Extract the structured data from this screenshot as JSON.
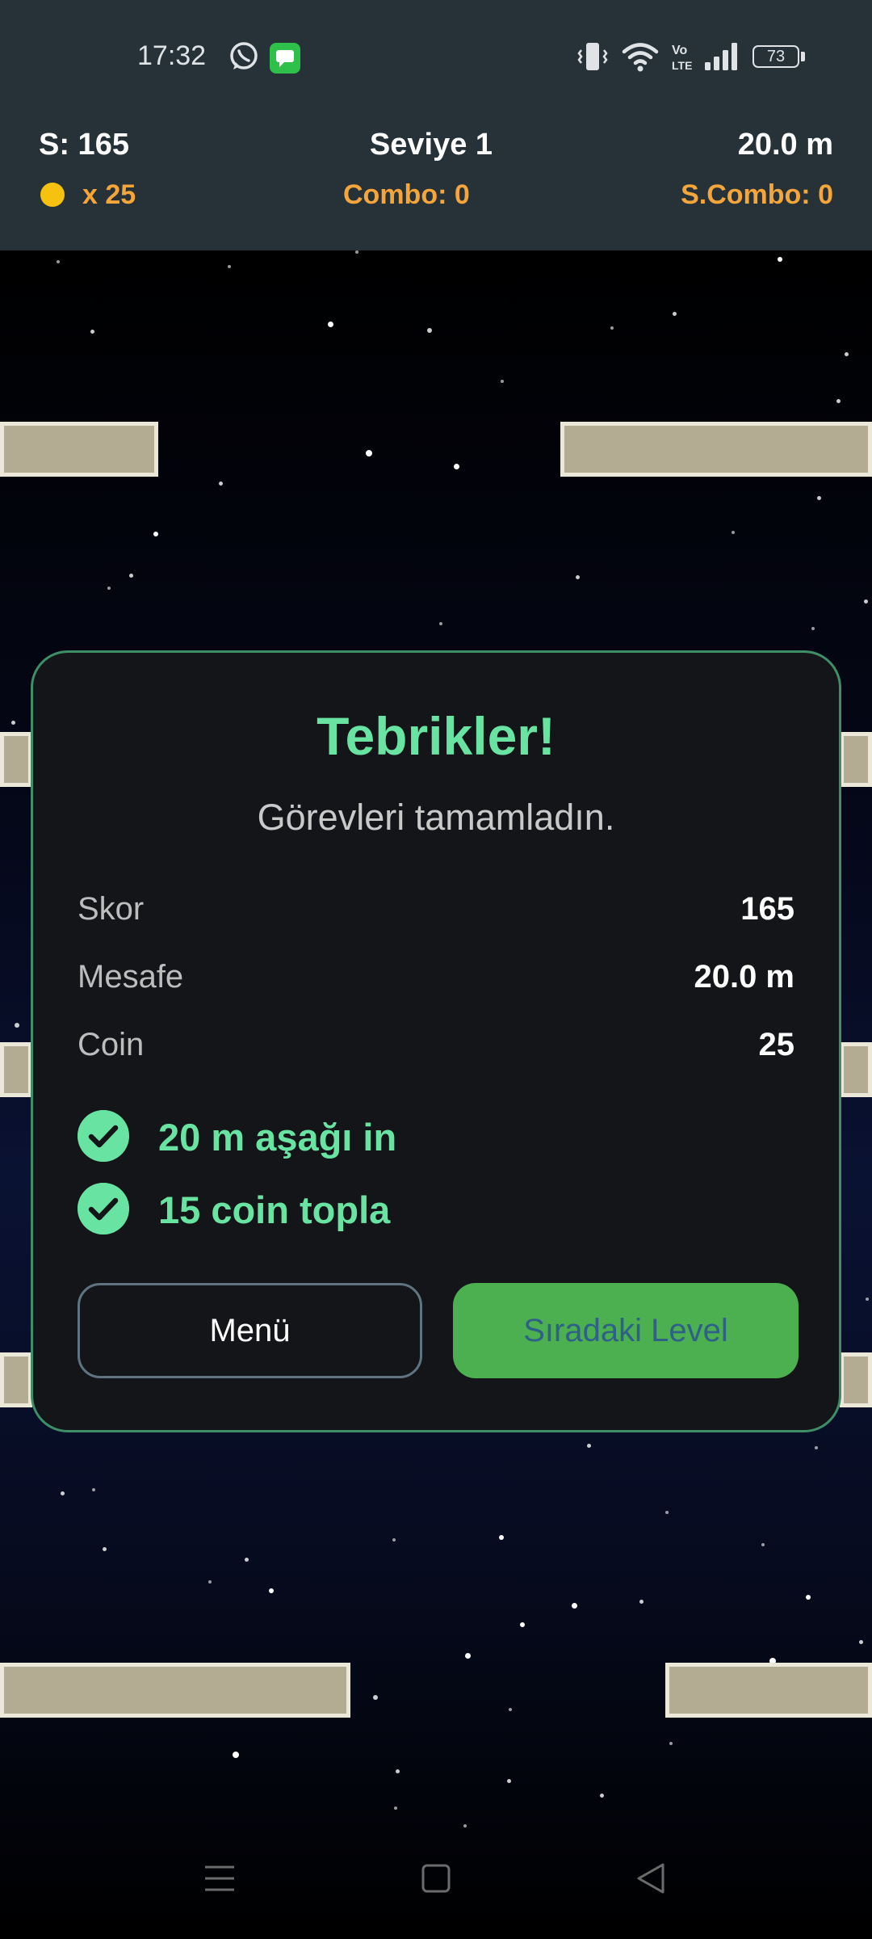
{
  "status_bar": {
    "time": "17:32",
    "icons": [
      "whatsapp-icon",
      "messages-icon",
      "vibrate-icon",
      "wifi-icon",
      "volte-icon",
      "signal-icon"
    ],
    "battery": "73"
  },
  "hud": {
    "score": "S: 165",
    "level": "Seviye 1",
    "distance": "20.0 m",
    "coins": "x 25",
    "combo": "Combo: 0",
    "super_combo": "S.Combo: 0",
    "colors": {
      "label": "#ffffff",
      "accent": "#f5a53a",
      "coin": "#f6c10f"
    }
  },
  "dialog": {
    "title": "Tebrikler!",
    "subtitle": "Görevleri tamamladın.",
    "stats": [
      {
        "label": "Skor",
        "value": "165"
      },
      {
        "label": "Mesafe",
        "value": "20.0 m"
      },
      {
        "label": "Coin",
        "value": "25"
      }
    ],
    "tasks": [
      {
        "label": "20 m aşağı in",
        "done": true
      },
      {
        "label": "15 coin topla",
        "done": true
      }
    ],
    "buttons": {
      "menu": "Menü",
      "next": "Sıradaki Level"
    },
    "colors": {
      "accent": "#69e3a1",
      "border": "#3e8f68",
      "next_bg": "#4caf50"
    }
  },
  "navbar": {
    "icons": [
      "menu-icon",
      "home-square-icon",
      "back-triangle-icon"
    ]
  }
}
